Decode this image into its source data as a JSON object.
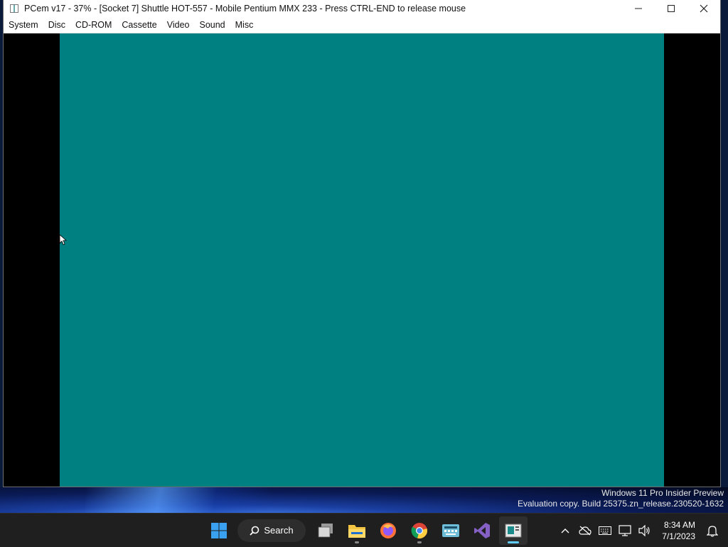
{
  "window": {
    "title": "PCem v17 - 37% - [Socket 7] Shuttle HOT-557 - Mobile Pentium MMX 233 - Press CTRL-END to release mouse",
    "controls": {
      "minimize": "—",
      "maximize": "☐",
      "close": "✕"
    }
  },
  "menu": {
    "items": [
      "System",
      "Disc",
      "CD-ROM",
      "Cassette",
      "Video",
      "Sound",
      "Misc"
    ]
  },
  "emulator": {
    "screen_color": "#008080"
  },
  "desktop": {
    "watermark_line1": "Windows 11 Pro Insider Preview",
    "watermark_line2": "Evaluation copy. Build 25375.zn_release.230520-1632"
  },
  "taskbar": {
    "search_label": "Search",
    "apps": [
      "start-icon",
      "task-view-icon",
      "file-explorer-icon",
      "firefox-icon",
      "chrome-icon",
      "keyboard-app-icon",
      "visual-studio-icon",
      "pcem-icon"
    ],
    "time": "8:34 AM",
    "date": "7/1/2023",
    "accent": "#60cdff"
  }
}
